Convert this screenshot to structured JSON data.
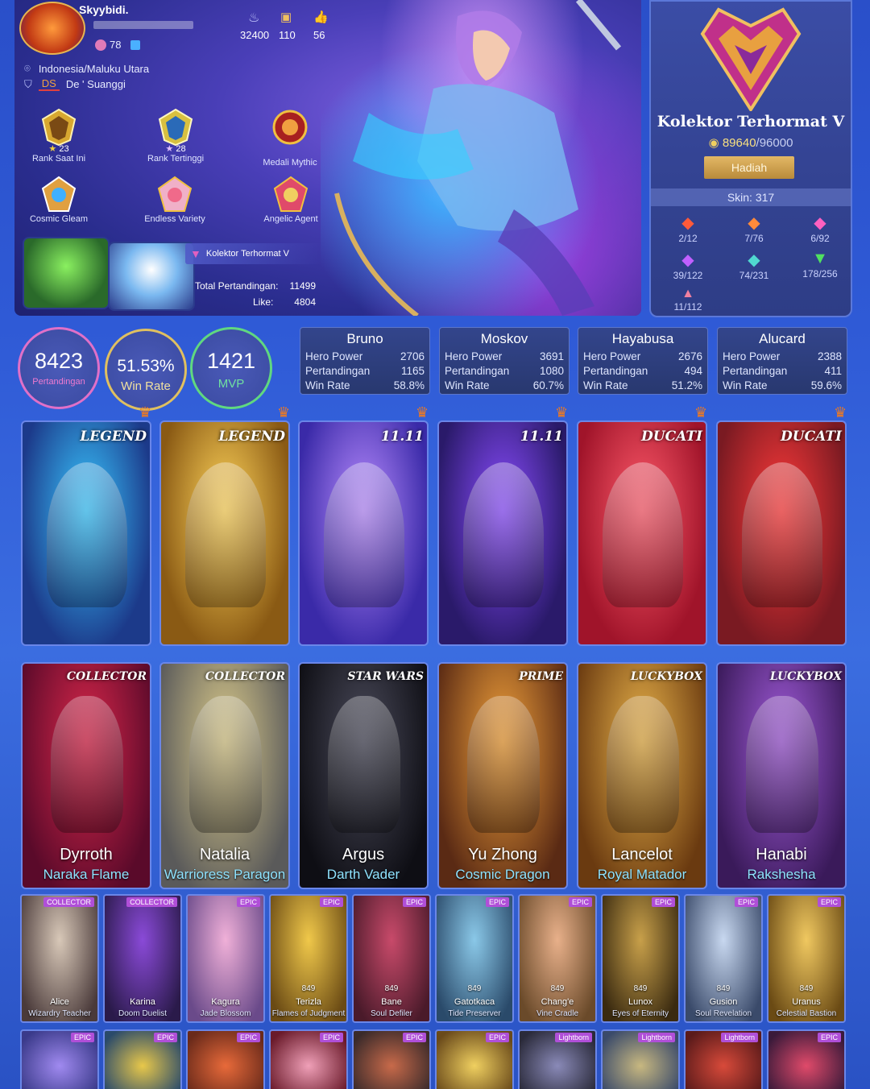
{
  "profile": {
    "name": "Skyybidi.",
    "level": "78",
    "stat_1": "32400",
    "stat_2": "110",
    "stat_3": "56",
    "location": "Indonesia/Maluku Utara",
    "squad_tag": "DS",
    "squad_name": "De ' Suanggi",
    "medals": [
      {
        "label": "Rank Saat Ini",
        "stars": "23"
      },
      {
        "label": "Rank Tertinggi",
        "stars": "28"
      },
      {
        "label": "Medali Mythic",
        "stars": ""
      },
      {
        "label": "Cosmic Gleam",
        "stars": ""
      },
      {
        "label": "Endless Variety",
        "stars": ""
      },
      {
        "label": "Angelic Agent",
        "stars": ""
      }
    ],
    "collector_badge": "Kolektor Terhormat V",
    "total_matches_label": "Total Pertandingan:",
    "total_matches": "11499",
    "like_label": "Like:",
    "likes": "4804"
  },
  "collector": {
    "title": "Kolektor Terhormat V",
    "points": "89640",
    "points_max": "/96000",
    "points_progress": 0.934,
    "reward_button": "Hadiah",
    "skin_count": "Skin: 317",
    "tiers": [
      "2/12",
      "7/76",
      "6/92",
      "39/122",
      "74/231",
      "178/256",
      "11/112"
    ]
  },
  "stats": {
    "matches": "8423",
    "matches_label": "Pertandingan",
    "win_rate": "51.53%",
    "win_rate_label": "Win Rate",
    "mvp": "1421",
    "mvp_label": "MVP"
  },
  "heroes": [
    {
      "name": "Bruno",
      "power": "2706",
      "matches": "1165",
      "win_rate": "58.8%"
    },
    {
      "name": "Moskov",
      "power": "3691",
      "matches": "1080",
      "win_rate": "60.7%"
    },
    {
      "name": "Hayabusa",
      "power": "2676",
      "matches": "494",
      "win_rate": "51.2%"
    },
    {
      "name": "Alucard",
      "power": "2388",
      "matches": "411",
      "win_rate": "59.6%"
    }
  ],
  "hero_labels": {
    "power": "Hero Power",
    "matches": "Pertandingan",
    "win_rate": "Win Rate"
  },
  "featured_skins": [
    {
      "badge": "LEGEND",
      "c1": "#1c3a8a",
      "c2": "#39c7ff"
    },
    {
      "badge": "LEGEND",
      "c1": "#8a5a14",
      "c2": "#ffd45a"
    },
    {
      "badge": "11.11",
      "c1": "#3a2aa8",
      "c2": "#b98cff"
    },
    {
      "badge": "11.11",
      "c1": "#2a1a6a",
      "c2": "#8a4cff"
    },
    {
      "badge": "DUCATI",
      "c1": "#a0142a",
      "c2": "#ff5a6a"
    },
    {
      "badge": "DUCATI",
      "c1": "#7a1a22",
      "c2": "#ff3a3a"
    }
  ],
  "premium_skins": [
    {
      "badge": "COLLECTOR",
      "hero": "Dyrroth",
      "skin": "Naraka Flame",
      "c1": "#5a0a2a",
      "c2": "#d8264a"
    },
    {
      "badge": "COLLECTOR",
      "hero": "Natalia",
      "skin": "Warrioress Paragon",
      "c1": "#5a5a5a",
      "c2": "#d9c98a"
    },
    {
      "badge": "STAR WARS",
      "hero": "Argus",
      "skin": "Darth Vader",
      "c1": "#0e0e14",
      "c2": "#4a4a5a"
    },
    {
      "badge": "PRIME",
      "hero": "Yu Zhong",
      "skin": "Cosmic Dragon",
      "c1": "#5a2a14",
      "c2": "#f0a03a"
    },
    {
      "badge": "LUCKYBOX",
      "hero": "Lancelot",
      "skin": "Royal Matador",
      "c1": "#6a3a10",
      "c2": "#e8b24a"
    },
    {
      "badge": "LUCKYBOX",
      "hero": "Hanabi",
      "skin": "Rakshesha",
      "c1": "#3a1a5a",
      "c2": "#a05ad8"
    }
  ],
  "epic_skins": [
    {
      "tag": "COLLECTOR",
      "price": "",
      "hero": "Alice",
      "skin": "Wizardry Teacher",
      "c1": "#4a3a3a",
      "c2": "#d8c8b8"
    },
    {
      "tag": "COLLECTOR",
      "price": "",
      "hero": "Karina",
      "skin": "Doom Duelist",
      "c1": "#2a1a4a",
      "c2": "#8a4ad8"
    },
    {
      "tag": "EPIC",
      "price": "",
      "hero": "Kagura",
      "skin": "Jade Blossom",
      "c1": "#6a4a8a",
      "c2": "#f0b0d8"
    },
    {
      "tag": "EPIC",
      "price": "849",
      "hero": "Terizla",
      "skin": "Flames of Judgment",
      "c1": "#6a4a14",
      "c2": "#f0c84a"
    },
    {
      "tag": "EPIC",
      "price": "849",
      "hero": "Bane",
      "skin": "Soul Defiler",
      "c1": "#4a1a2a",
      "c2": "#c84a6a"
    },
    {
      "tag": "EPIC",
      "price": "849",
      "hero": "Gatotkaca",
      "skin": "Tide Preserver",
      "c1": "#2a4a6a",
      "c2": "#8ac8e8"
    },
    {
      "tag": "EPIC",
      "price": "849",
      "hero": "Chang'e",
      "skin": "Vine Cradle",
      "c1": "#6a4a2a",
      "c2": "#e8b08a"
    },
    {
      "tag": "EPIC",
      "price": "849",
      "hero": "Lunox",
      "skin": "Eyes of Eternity",
      "c1": "#3a2a10",
      "c2": "#c8a04a"
    },
    {
      "tag": "EPIC",
      "price": "849",
      "hero": "Gusion",
      "skin": "Soul Revelation",
      "c1": "#3a4a6a",
      "c2": "#c8d8f0"
    },
    {
      "tag": "EPIC",
      "price": "849",
      "hero": "Uranus",
      "skin": "Celestial Bastion",
      "c1": "#6a4a14",
      "c2": "#f0c860"
    }
  ],
  "bottom_row": [
    {
      "tag": "EPIC",
      "c1": "#3a3a8a",
      "c2": "#a08af0"
    },
    {
      "tag": "EPIC",
      "c1": "#2a4a6a",
      "c2": "#e8c84a"
    },
    {
      "tag": "EPIC",
      "c1": "#6a2a1a",
      "c2": "#e86a3a"
    },
    {
      "tag": "EPIC",
      "c1": "#6a1a2a",
      "c2": "#f0a0b8"
    },
    {
      "tag": "EPIC",
      "c1": "#3a2a2a",
      "c2": "#c86a4a"
    },
    {
      "tag": "EPIC",
      "c1": "#6a4a1a",
      "c2": "#f0d060"
    },
    {
      "tag": "Lightborn",
      "c1": "#2a2a3a",
      "c2": "#8a8ab8"
    },
    {
      "tag": "Lightborn",
      "c1": "#3a4a6a",
      "c2": "#c8b880"
    },
    {
      "tag": "Lightborn",
      "c1": "#5a1a1a",
      "c2": "#d84a3a"
    },
    {
      "tag": "EPIC",
      "c1": "#3a1a3a",
      "c2": "#e04a6a"
    }
  ]
}
